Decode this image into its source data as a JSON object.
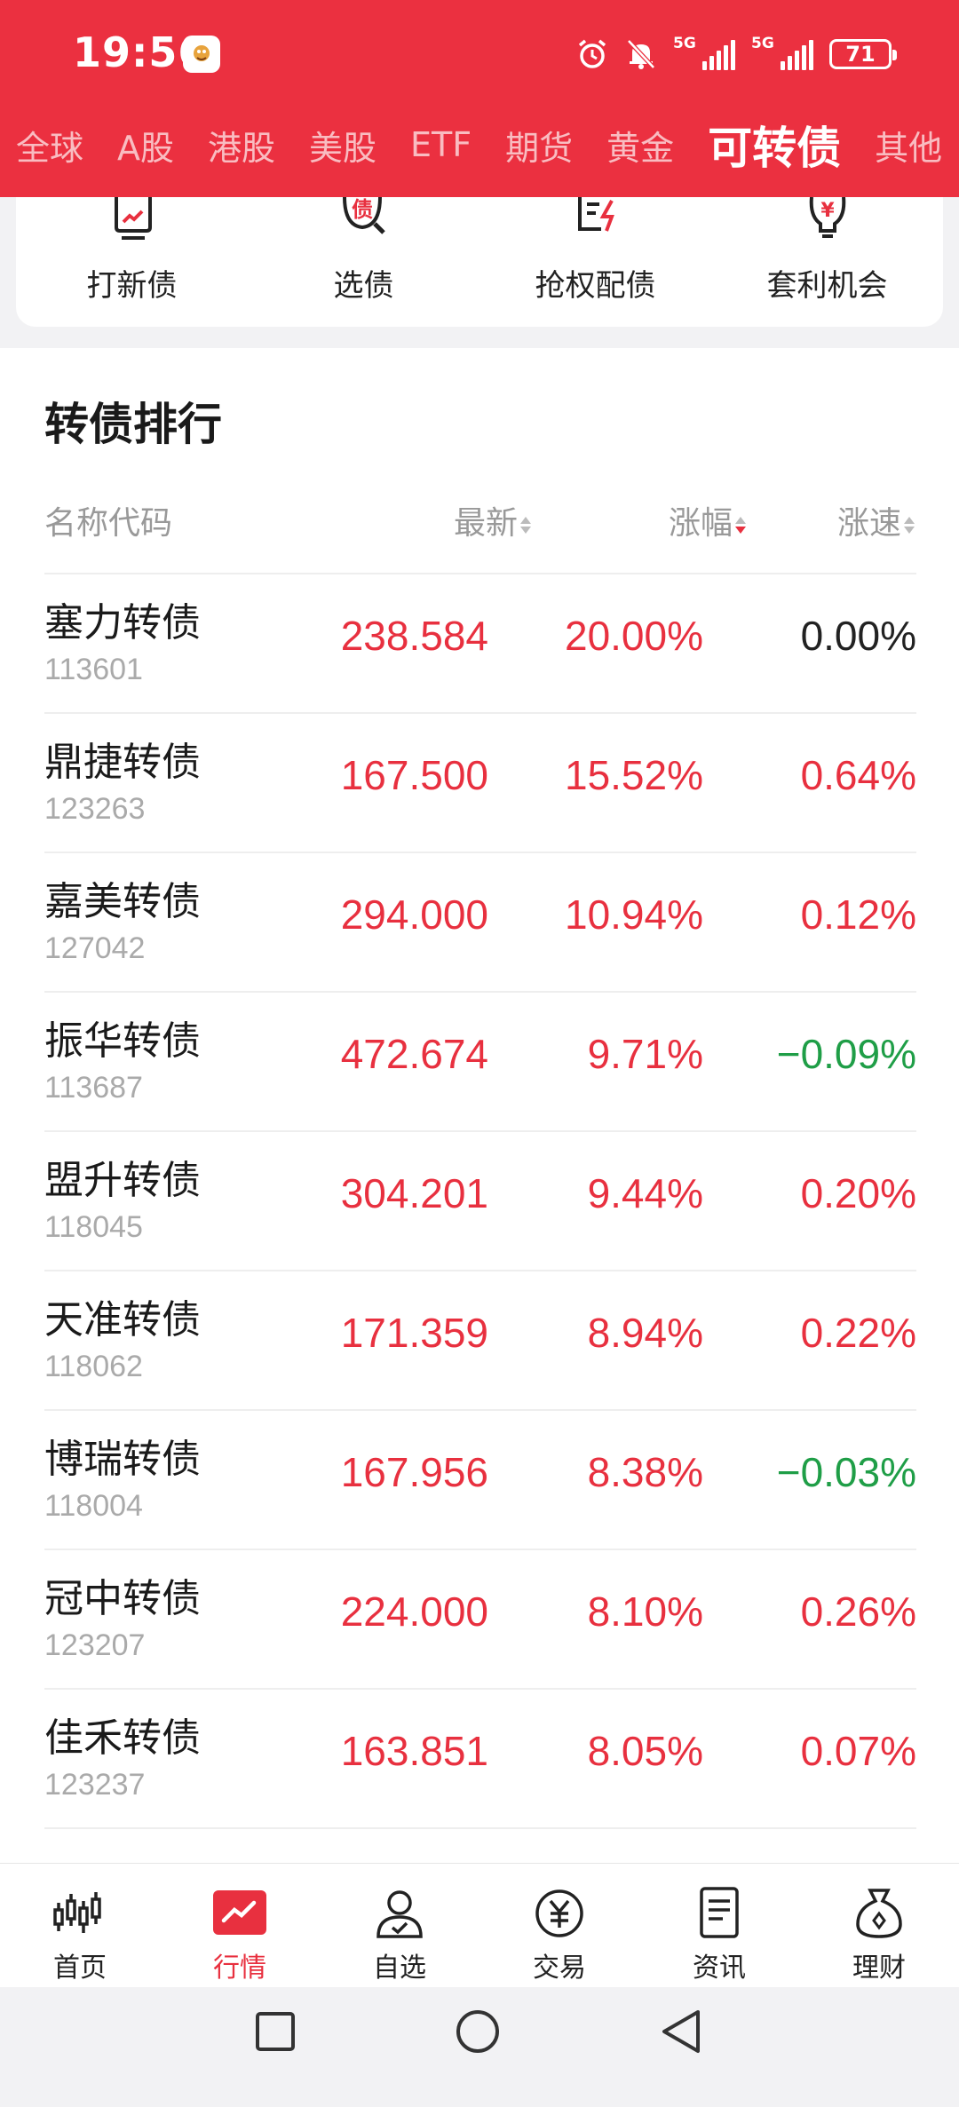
{
  "status_bar": {
    "time": "19:56",
    "net1": "5G",
    "net2": "5G",
    "battery": "71"
  },
  "tabs": [
    {
      "label": "全球"
    },
    {
      "label": "A股"
    },
    {
      "label": "港股"
    },
    {
      "label": "美股"
    },
    {
      "label": "ETF"
    },
    {
      "label": "期货"
    },
    {
      "label": "黄金"
    },
    {
      "label": "可转债",
      "active": true
    },
    {
      "label": "其他"
    }
  ],
  "quick_entries": [
    {
      "label": "打新债",
      "icon": "new-bond-icon"
    },
    {
      "label": "选债",
      "icon": "select-bond-icon"
    },
    {
      "label": "抢权配债",
      "icon": "rights-bond-icon"
    },
    {
      "label": "套利机会",
      "icon": "arbitrage-icon"
    }
  ],
  "ranking": {
    "title": "转债排行",
    "headers": {
      "name": "名称代码",
      "last": "最新",
      "change": "涨幅",
      "speed": "涨速"
    },
    "sort_key": "change",
    "sort_order": "desc",
    "rows": [
      {
        "name": "塞力转债",
        "code": "113601",
        "last": "238.584",
        "change": "20.00%",
        "speed": "0.00%",
        "speed_dir": "flat"
      },
      {
        "name": "鼎捷转债",
        "code": "123263",
        "last": "167.500",
        "change": "15.52%",
        "speed": "0.64%",
        "speed_dir": "up"
      },
      {
        "name": "嘉美转债",
        "code": "127042",
        "last": "294.000",
        "change": "10.94%",
        "speed": "0.12%",
        "speed_dir": "up"
      },
      {
        "name": "振华转债",
        "code": "113687",
        "last": "472.674",
        "change": "9.71%",
        "speed": "−0.09%",
        "speed_dir": "down"
      },
      {
        "name": "盟升转债",
        "code": "118045",
        "last": "304.201",
        "change": "9.44%",
        "speed": "0.20%",
        "speed_dir": "up"
      },
      {
        "name": "天准转债",
        "code": "118062",
        "last": "171.359",
        "change": "8.94%",
        "speed": "0.22%",
        "speed_dir": "up"
      },
      {
        "name": "博瑞转债",
        "code": "118004",
        "last": "167.956",
        "change": "8.38%",
        "speed": "−0.03%",
        "speed_dir": "down"
      },
      {
        "name": "冠中转债",
        "code": "123207",
        "last": "224.000",
        "change": "8.10%",
        "speed": "0.26%",
        "speed_dir": "up"
      },
      {
        "name": "佳禾转债",
        "code": "123237",
        "last": "163.851",
        "change": "8.05%",
        "speed": "0.07%",
        "speed_dir": "up"
      }
    ]
  },
  "bottom_nav": [
    {
      "label": "首页",
      "icon": "home-candles-icon"
    },
    {
      "label": "行情",
      "icon": "market-chart-icon",
      "active": true
    },
    {
      "label": "自选",
      "icon": "watchlist-user-icon"
    },
    {
      "label": "交易",
      "icon": "trade-yen-icon"
    },
    {
      "label": "资讯",
      "icon": "news-doc-icon"
    },
    {
      "label": "理财",
      "icon": "wealth-bag-icon"
    }
  ],
  "colors": {
    "brand_red": "#eb3040",
    "up": "#e8303f",
    "down": "#1f9e47"
  }
}
